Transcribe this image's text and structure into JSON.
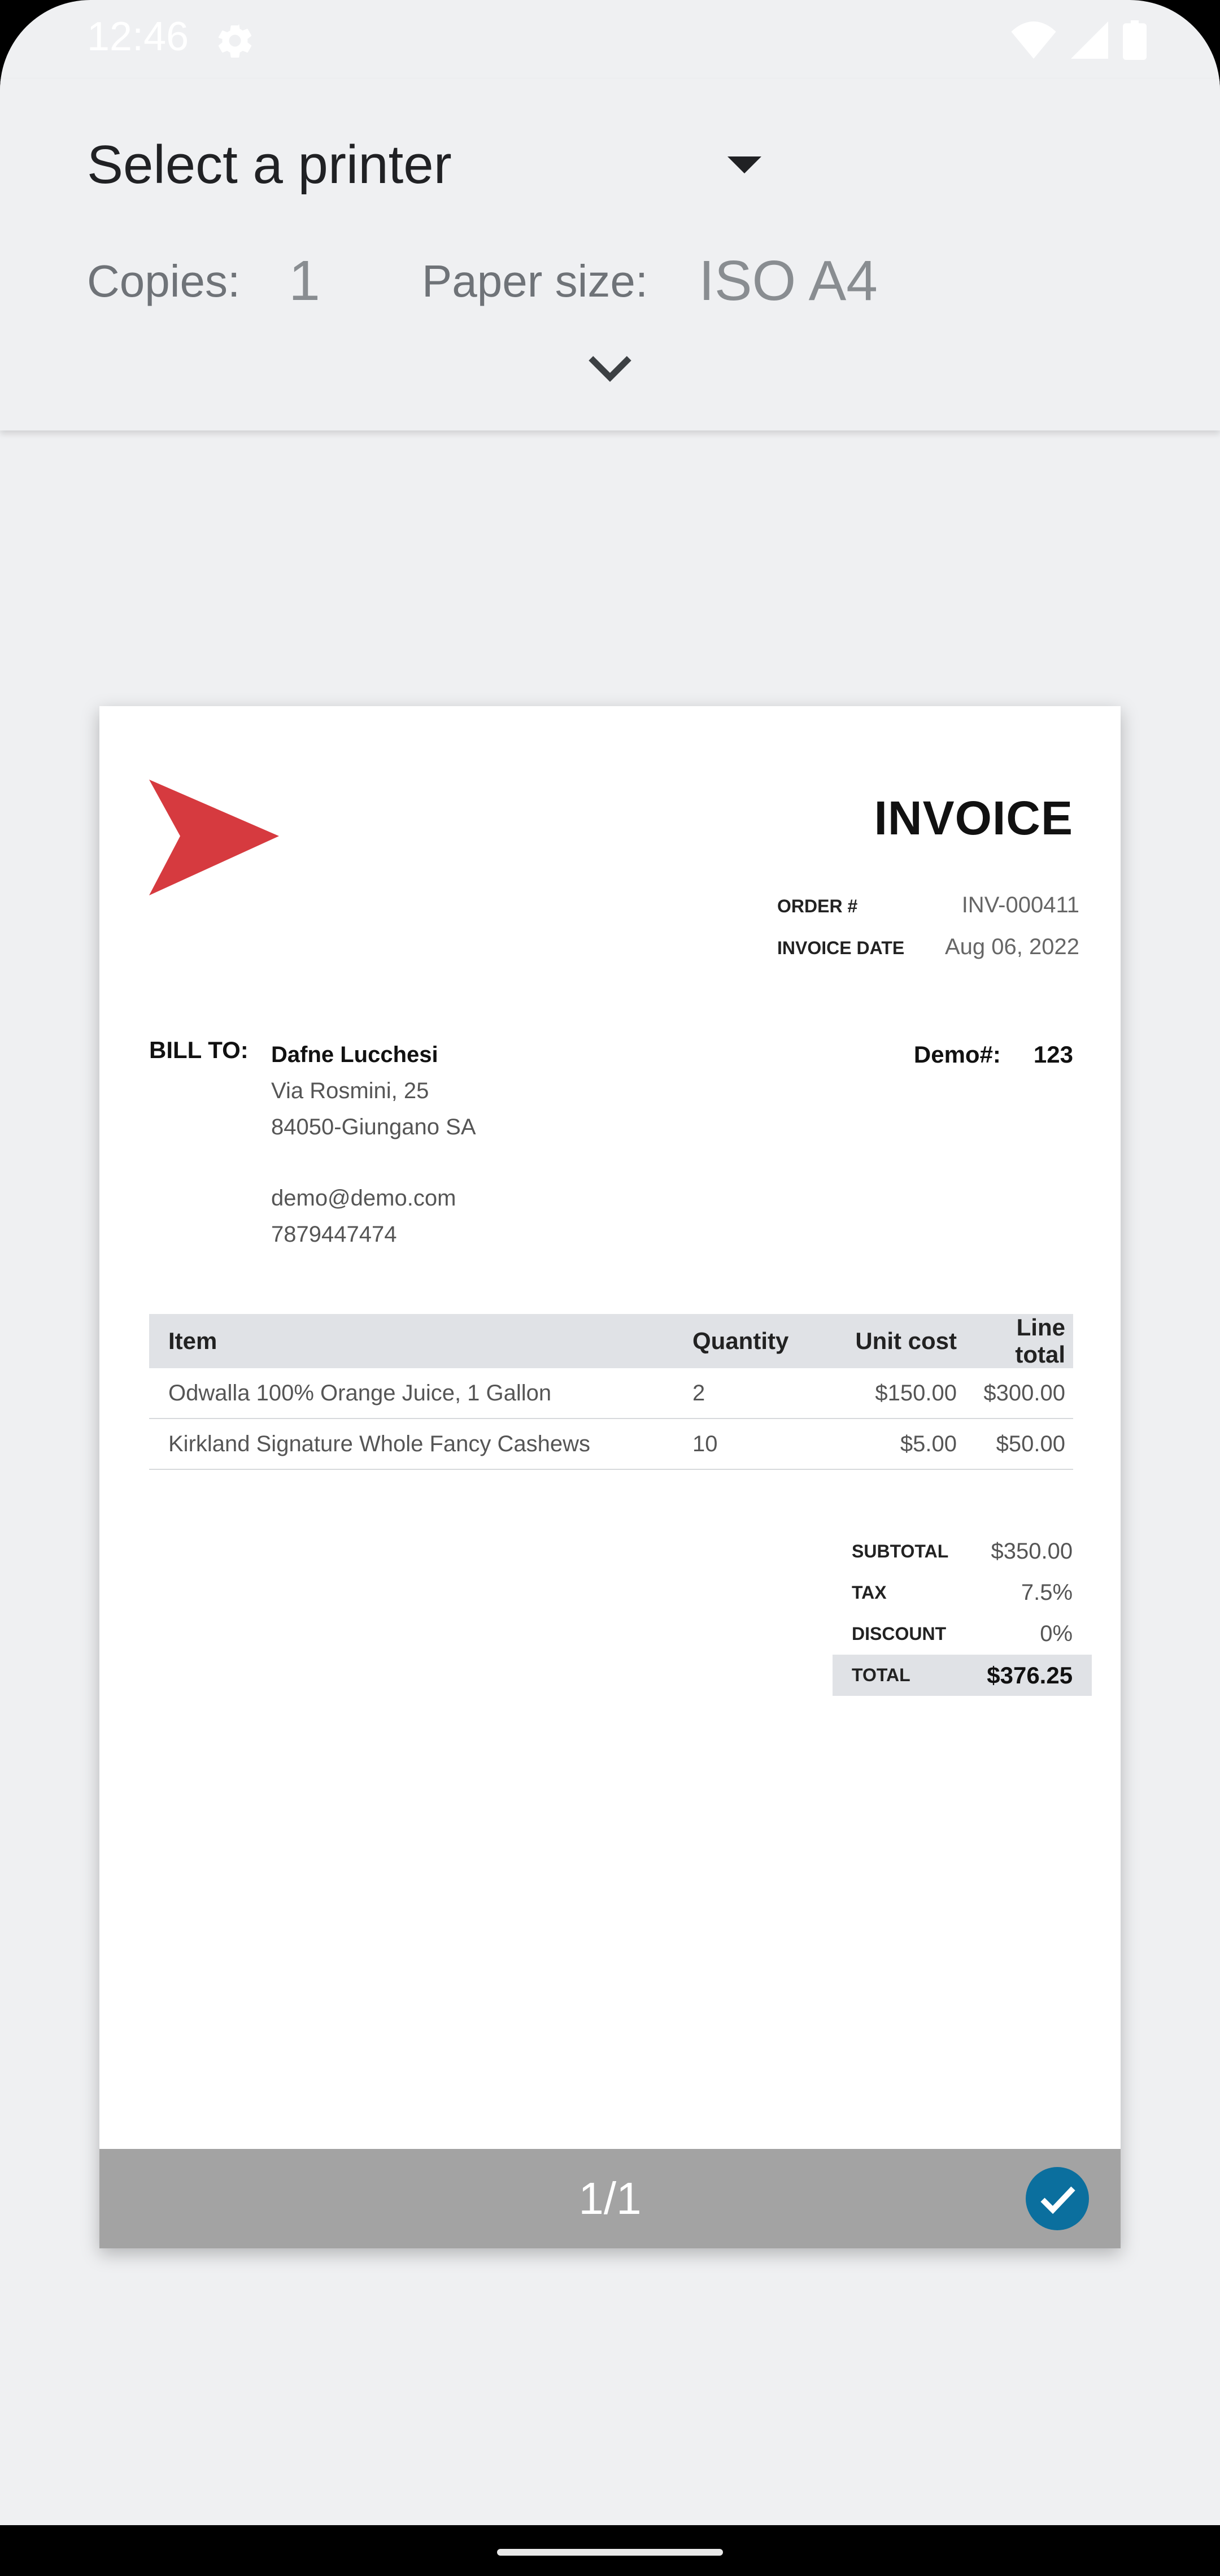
{
  "status_bar": {
    "time": "12:46"
  },
  "header": {
    "printer_label": "Select a printer",
    "copies_label": "Copies:",
    "copies_value": "1",
    "paper_label": "Paper size:",
    "paper_value": "ISO A4"
  },
  "invoice": {
    "title": "INVOICE",
    "order_label": "ORDER #",
    "order_value": "INV-000411",
    "date_label": "INVOICE DATE",
    "date_value": "Aug 06, 2022",
    "bill_to_label": "BILL TO:",
    "bill_to": {
      "name": "Dafne Lucchesi",
      "address1": "Via Rosmini, 25",
      "address2": "84050-Giungano SA",
      "email": "demo@demo.com",
      "phone": "7879447474"
    },
    "demo_label": "Demo#:",
    "demo_value": "123",
    "table": {
      "headers": {
        "item": "Item",
        "quantity": "Quantity",
        "unit_cost": "Unit cost",
        "line_total": "Line total"
      },
      "rows": [
        {
          "item": "Odwalla 100% Orange Juice, 1 Gallon",
          "quantity": "2",
          "unit_cost": "$150.00",
          "line_total": "$300.00"
        },
        {
          "item": "Kirkland Signature Whole Fancy Cashews",
          "quantity": "10",
          "unit_cost": "$5.00",
          "line_total": "$50.00"
        }
      ]
    },
    "totals": {
      "subtotal_label": "SUBTOTAL",
      "subtotal_value": "$350.00",
      "tax_label": "TAX",
      "tax_value": "7.5%",
      "discount_label": "DISCOUNT",
      "discount_value": "0%",
      "total_label": "TOTAL",
      "total_value": "$376.25"
    }
  },
  "preview": {
    "page_indicator": "1/1"
  },
  "colors": {
    "logo_red": "#d63a3f",
    "check_blue": "#0b6f9e",
    "footer_gray": "#a3a3a3"
  }
}
